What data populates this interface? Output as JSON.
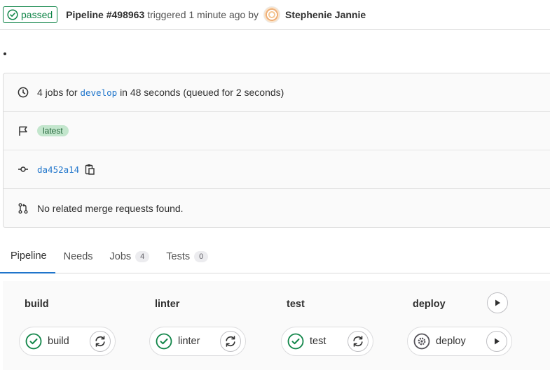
{
  "header": {
    "status": "passed",
    "pipeline_title": "Pipeline #498963",
    "triggered_text": "triggered 1 minute ago by",
    "author": "Stephenie Jannie"
  },
  "info": {
    "jobs_prefix": "4 jobs for",
    "branch": "develop",
    "jobs_suffix": "in 48 seconds (queued for 2 seconds)",
    "tag": "latest",
    "commit": "da452a14",
    "mr_text": "No related merge requests found."
  },
  "tabs": [
    {
      "label": "Pipeline",
      "count": null
    },
    {
      "label": "Needs",
      "count": null
    },
    {
      "label": "Jobs",
      "count": "4"
    },
    {
      "label": "Tests",
      "count": "0"
    }
  ],
  "stages": [
    {
      "name": "build",
      "job": "build",
      "job_status": "success",
      "action": "retry"
    },
    {
      "name": "linter",
      "job": "linter",
      "job_status": "success",
      "action": "retry"
    },
    {
      "name": "test",
      "job": "test",
      "job_status": "success",
      "action": "retry"
    },
    {
      "name": "deploy",
      "job": "deploy",
      "job_status": "manual",
      "action": "play"
    }
  ],
  "colors": {
    "success": "#108548",
    "link": "#1f75cb",
    "tab_active": "#1f75cb"
  }
}
